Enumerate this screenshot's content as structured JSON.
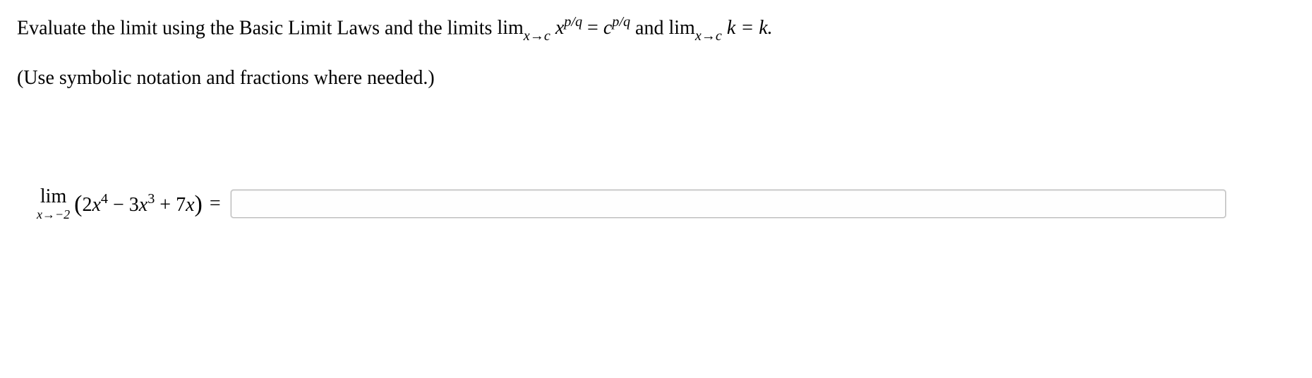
{
  "problem": {
    "line1_prefix": "Evaluate the limit using the Basic Limit Laws and the limits ",
    "law1_lim": "lim",
    "law1_sub": "x→c",
    "law1_lhs_var": "x",
    "law1_lhs_exp": "p/q",
    "law1_eq": " = ",
    "law1_rhs_var": "c",
    "law1_rhs_exp": "p/q",
    "line1_mid": " and ",
    "law2_lim": "lim",
    "law2_sub": "x→c",
    "law2_rhs": " k = k.",
    "line2": "(Use symbolic notation and fractions where needed.)"
  },
  "question": {
    "lim_label": "lim",
    "lim_sub": "x→−2",
    "open_paren": "(",
    "t1_coef": "2",
    "t1_var": "x",
    "t1_exp": "4",
    "op1": " − ",
    "t2_coef": "3",
    "t2_var": "x",
    "t2_exp": "3",
    "op2": " + ",
    "t3_coef": "7",
    "t3_var": "x",
    "close_paren": ")",
    "equals": " = "
  },
  "answer": {
    "value": "",
    "placeholder": ""
  }
}
